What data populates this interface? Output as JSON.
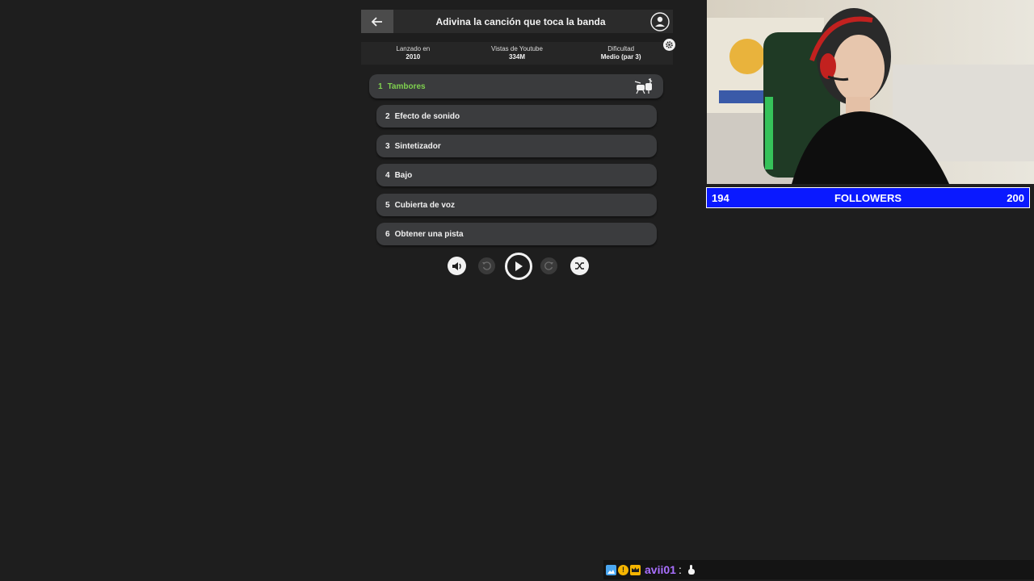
{
  "game": {
    "title": "Adivina la canción que toca la banda",
    "info": [
      {
        "label": "Lanzado en",
        "value": "2010"
      },
      {
        "label": "Vistas de Youtube",
        "value": "334M"
      },
      {
        "label": "Dificultad",
        "value": "Medio (par 3)"
      }
    ],
    "tracks": [
      {
        "num": "1",
        "label": "Tambores",
        "active": true
      },
      {
        "num": "2",
        "label": "Efecto de sonido"
      },
      {
        "num": "3",
        "label": "Sintetizador"
      },
      {
        "num": "4",
        "label": "Bajo"
      },
      {
        "num": "5",
        "label": "Cubierta de voz"
      },
      {
        "num": "6",
        "label": "Obtener una pista"
      }
    ],
    "controls": [
      "volume-icon",
      "rewind-5-icon",
      "play-icon",
      "forward-5-icon",
      "shuffle-icon"
    ],
    "colors": {
      "active_track": "#7fd14f",
      "highlight": "#2f5a9e"
    }
  },
  "followers": {
    "current": "194",
    "label": "FOLLOWERS",
    "goal": "200",
    "bar_color": "#0a19ff"
  },
  "chat": {
    "username": "avii01",
    "separator": ":",
    "message_icon": "hand-pointing-icon"
  }
}
